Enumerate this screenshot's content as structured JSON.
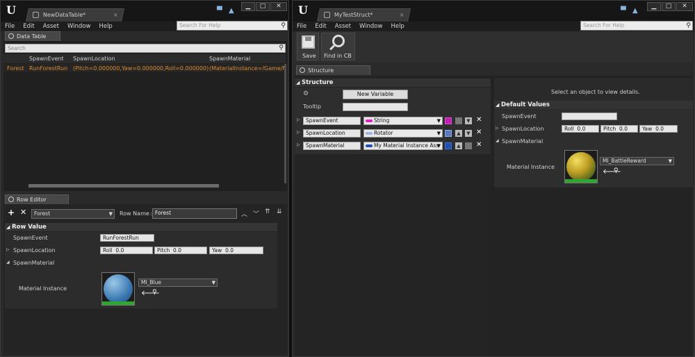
{
  "left_window": {
    "doc_tab": "NewDataTable*",
    "menu": [
      "File",
      "Edit",
      "Asset",
      "Window",
      "Help"
    ],
    "help_search_placeholder": "Search For Help",
    "datatable_panel": {
      "tab_label": "Data Table",
      "search_placeholder": "Search",
      "columns": [
        "SpawnEvent",
        "SpawnLocation",
        "SpawnMaterial"
      ],
      "rows": [
        {
          "name": "Forest",
          "SpawnEvent": "RunForestRun",
          "SpawnLocation": "(Pitch=0.000000,Yaw=0.000000,Roll=0.000000)",
          "SpawnMaterial": "(MaterialInstance=/Game/M"
        }
      ]
    },
    "row_editor": {
      "tab_label": "Row Editor",
      "selected_row": "Forest",
      "row_name_label": "Row Name",
      "row_name_value": "Forest",
      "section_title": "Row Value",
      "props": {
        "spawn_event_label": "SpawnEvent",
        "spawn_event_value": "RunForestRun",
        "spawn_location_label": "SpawnLocation",
        "roll_label": "Roll",
        "roll_value": "0.0",
        "pitch_label": "Pitch",
        "pitch_value": "0.0",
        "yaw_label": "Yaw",
        "yaw_value": "0.0",
        "spawn_material_label": "SpawnMaterial",
        "material_instance_label": "Material Instance",
        "material_value": "MI_Blue"
      }
    }
  },
  "right_window": {
    "doc_tab": "MyTestStruct*",
    "menu": [
      "File",
      "Edit",
      "Asset",
      "Window",
      "Help"
    ],
    "help_search_placeholder": "Search For Help",
    "toolbar": {
      "save_label": "Save",
      "find_label": "Find in CB"
    },
    "structure_panel": {
      "tab_label": "Structure",
      "section_title": "Structure",
      "new_variable_label": "New Variable",
      "tooltip_label": "Tooltip",
      "variables": [
        {
          "name": "SpawnEvent",
          "type": "String",
          "color": "#e020c0"
        },
        {
          "name": "SpawnLocation",
          "type": "Rotator",
          "color": "#9ab4e8"
        },
        {
          "name": "SpawnMaterial",
          "type": "My Material Instance Ass",
          "color": "#2050b0"
        }
      ]
    },
    "details_panel": {
      "hint": "Select an object to view details.",
      "section_title": "Default Values",
      "spawn_event_label": "SpawnEvent",
      "spawn_location_label": "SpawnLocation",
      "roll_label": "Roll",
      "roll_value": "0.0",
      "pitch_label": "Pitch",
      "pitch_value": "0.0",
      "yaw_label": "Yaw",
      "yaw_value": "0.0",
      "spawn_material_label": "SpawnMaterial",
      "material_instance_label": "Material Instance",
      "material_value": "MI_BattleReward"
    }
  },
  "colors": {
    "row_highlight_text": "#e08a2c",
    "accent_blue": "#8ab4e0"
  },
  "icons": [
    "unreal-logo-icon",
    "asset-tab-icon",
    "chat-icon",
    "graduation-cap-icon",
    "minimize-icon",
    "maximize-icon",
    "close-icon",
    "search-icon",
    "save-icon",
    "find-in-cb-icon",
    "add-icon",
    "remove-icon",
    "move-up-icon",
    "move-down-icon",
    "browse-icon",
    "use-selected-arrow-icon"
  ]
}
